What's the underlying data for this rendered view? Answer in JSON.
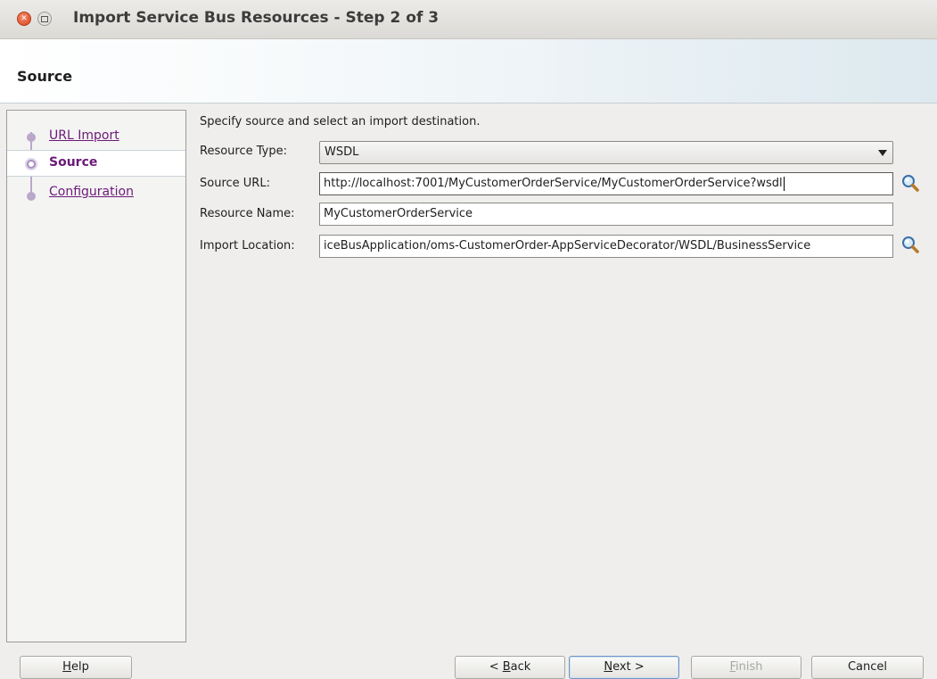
{
  "window": {
    "title": "Import Service Bus Resources - Step 2 of 3",
    "close_glyph": "✕"
  },
  "banner": {
    "title": "Source"
  },
  "steps": [
    {
      "label": "URL Import",
      "state": "link"
    },
    {
      "label": "Source",
      "state": "active"
    },
    {
      "label": "Configuration",
      "state": "link"
    }
  ],
  "form": {
    "instruction": "Specify source and select an import destination.",
    "resource_type": {
      "label": "Resource Type:",
      "value": "WSDL"
    },
    "source_url": {
      "label": "Source URL:",
      "value": "http://localhost:7001/MyCustomerOrderService/MyCustomerOrderService?wsdl"
    },
    "resource_name": {
      "label": "Resource Name:",
      "value": "MyCustomerOrderService"
    },
    "import_location": {
      "label": "Import Location:",
      "value": "iceBusApplication/oms-CustomerOrder-AppServiceDecorator/WSDL/BusinessService"
    }
  },
  "buttons": {
    "help": {
      "before": "",
      "mnemonic": "H",
      "after": "elp"
    },
    "back": {
      "before": "< ",
      "mnemonic": "B",
      "after": "ack"
    },
    "next": {
      "before": "",
      "mnemonic": "N",
      "after": "ext >"
    },
    "finish": {
      "before": "",
      "mnemonic": "F",
      "after": "inish"
    },
    "cancel": {
      "before": "",
      "mnemonic": "",
      "after": "Cancel"
    }
  },
  "colors": {
    "link": "#6b1a78",
    "accent": "#6e96c4"
  }
}
